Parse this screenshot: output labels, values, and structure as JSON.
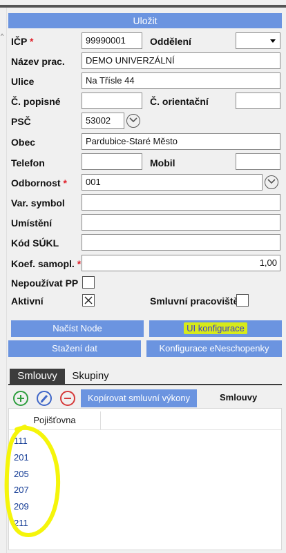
{
  "save_label": "Uložit",
  "fields": {
    "icp": {
      "label": "IČP",
      "required_mark": "*",
      "value": "99990001"
    },
    "oddeleni": {
      "label": "Oddělení",
      "value": ""
    },
    "nazev": {
      "label": "Název prac.",
      "value": "DEMO UNIVERZÁLNÍ"
    },
    "ulice": {
      "label": "Ulice",
      "value": "Na Třísle 44"
    },
    "c_popisne": {
      "label": "Č. popisné",
      "value": ""
    },
    "c_orientacni": {
      "label": "Č. orientační",
      "value": ""
    },
    "psc": {
      "label": "PSČ",
      "value": "53002"
    },
    "obec": {
      "label": "Obec",
      "value": "Pardubice-Staré Město"
    },
    "telefon": {
      "label": "Telefon",
      "value": ""
    },
    "mobil": {
      "label": "Mobil",
      "value": ""
    },
    "odbornost": {
      "label": "Odbornost",
      "required_mark": "*",
      "value": "001"
    },
    "var_symbol": {
      "label": "Var. symbol",
      "value": ""
    },
    "umisteni": {
      "label": "Umístění",
      "value": ""
    },
    "kod_sukl": {
      "label": "Kód SÚKL",
      "value": ""
    },
    "koef": {
      "label": "Koef. samopl.",
      "required_mark": "*",
      "value": "1,00"
    },
    "nepouzivat_pp": {
      "label": "Nepoužívat PP",
      "checked": false
    },
    "aktivni": {
      "label": "Aktivní",
      "checked": true
    },
    "smluvni": {
      "label": "Smluvní pracoviště",
      "checked": false
    }
  },
  "buttons": {
    "nacist_node": "Načíst Node",
    "ui_konfigurace": "UI konfigurace",
    "stazeni_dat": "Stažení dat",
    "konfigurace_eneschopenky": "Konfigurace eNeschopenky"
  },
  "tabs": [
    {
      "label": "Smlouvy",
      "active": true
    },
    {
      "label": "Skupiny",
      "active": false
    }
  ],
  "toolbar": {
    "copy_button": "Kopírovat smluvní výkony",
    "section_title": "Smlouvy",
    "icons": [
      "add-icon",
      "edit-icon",
      "remove-icon"
    ]
  },
  "grid": {
    "column_header": "Pojišťovna",
    "rows": [
      "111",
      "201",
      "205",
      "207",
      "209",
      "211"
    ]
  },
  "colors": {
    "accent": "#6b94e0",
    "required": "#e0202a",
    "highlight": "#d6ea1a",
    "annotation": "#f5f50a"
  }
}
